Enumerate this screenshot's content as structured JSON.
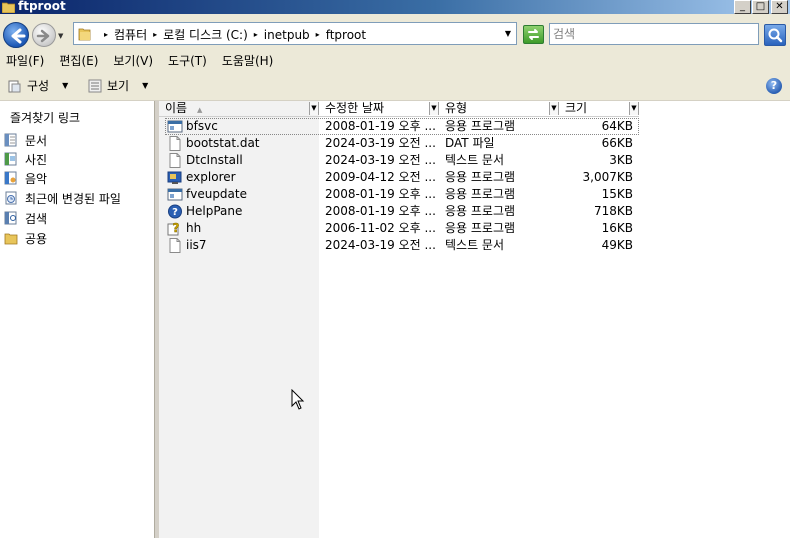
{
  "window": {
    "title": "ftproot"
  },
  "navigation": {
    "breadcrumbs": [
      "컴퓨터",
      "로컬 디스크 (C:)",
      "inetpub",
      "ftproot"
    ],
    "search_placeholder": "검색"
  },
  "menu": [
    "파일(F)",
    "편집(E)",
    "보기(V)",
    "도구(T)",
    "도움말(H)"
  ],
  "toolbar": {
    "organize_label": "구성",
    "views_label": "보기",
    "help_glyph": "?"
  },
  "favorites": {
    "title": "즐겨찾기 링크",
    "items": [
      {
        "label": "문서",
        "icon": "documents-icon"
      },
      {
        "label": "사진",
        "icon": "pictures-icon"
      },
      {
        "label": "음악",
        "icon": "music-icon"
      },
      {
        "label": "최근에 변경된 파일",
        "icon": "recent-files-icon"
      },
      {
        "label": "검색",
        "icon": "searches-icon"
      },
      {
        "label": "공용",
        "icon": "public-folder-icon"
      }
    ]
  },
  "columns": [
    "이름",
    "수정한 날짜",
    "유형",
    "크기"
  ],
  "files": [
    {
      "name": "bfsvc",
      "date": "2008-01-19 오후 ...",
      "type": "응용 프로그램",
      "size": "64KB",
      "icon": "application-icon"
    },
    {
      "name": "bootstat.dat",
      "date": "2024-03-19 오전 ...",
      "type": "DAT 파일",
      "size": "66KB",
      "icon": "file-icon"
    },
    {
      "name": "DtcInstall",
      "date": "2024-03-19 오전 ...",
      "type": "텍스트 문서",
      "size": "3KB",
      "icon": "text-document-icon"
    },
    {
      "name": "explorer",
      "date": "2009-04-12 오전 ...",
      "type": "응용 프로그램",
      "size": "3,007KB",
      "icon": "explorer-app-icon"
    },
    {
      "name": "fveupdate",
      "date": "2008-01-19 오후 ...",
      "type": "응용 프로그램",
      "size": "15KB",
      "icon": "application-icon"
    },
    {
      "name": "HelpPane",
      "date": "2008-01-19 오후 ...",
      "type": "응용 프로그램",
      "size": "718KB",
      "icon": "help-icon"
    },
    {
      "name": "hh",
      "date": "2006-11-02 오후 ...",
      "type": "응용 프로그램",
      "size": "16KB",
      "icon": "help-app-icon"
    },
    {
      "name": "iis7",
      "date": "2024-03-19 오전 ...",
      "type": "텍스트 문서",
      "size": "49KB",
      "icon": "text-document-icon"
    }
  ]
}
